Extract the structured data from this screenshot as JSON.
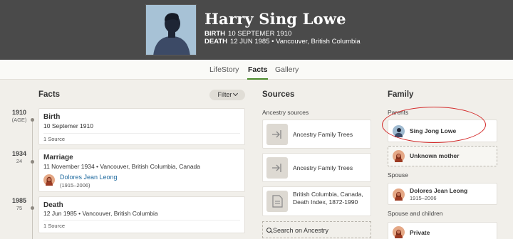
{
  "header": {
    "name": "Harry Sing Lowe",
    "birth": {
      "label": "BIRTH",
      "value": "10 SEPTEMER 1910"
    },
    "death": {
      "label": "DEATH",
      "value": "12 JUN 1985 • Vancouver, British Columbia"
    }
  },
  "tabs": [
    {
      "label": "LifeStory",
      "active": false
    },
    {
      "label": "Facts",
      "active": true
    },
    {
      "label": "Gallery",
      "active": false
    }
  ],
  "facts": {
    "heading": "Facts",
    "filter_label": "Filter",
    "items": [
      {
        "year": "1910",
        "age": "(AGE)",
        "title": "Birth",
        "date": "10 Septemer 1910",
        "sources": "1 Source"
      },
      {
        "year": "1934",
        "age": "24",
        "title": "Marriage",
        "date": "11 November 1934 • Vancouver, British Columbia, Canada",
        "person_name": "Dolores Jean Leong",
        "person_years": "(1915–2006)"
      },
      {
        "year": "1985",
        "age": "75",
        "title": "Death",
        "date": "12 Jun 1985 • Vancouver, British Columbia",
        "sources": "1 Source"
      }
    ]
  },
  "sources": {
    "heading": "Sources",
    "subheading": "Ancestry sources",
    "items": [
      {
        "label": "Ancestry Family Trees",
        "icon": "tree-icon"
      },
      {
        "label": "Ancestry Family Trees",
        "icon": "tree-icon"
      },
      {
        "label": "British Columbia, Canada, Death Index, 1872-1990",
        "icon": "document-icon"
      }
    ],
    "search_label": "Search on Ancestry"
  },
  "family": {
    "heading": "Family",
    "parents_label": "Parents",
    "parents": [
      {
        "name": "Sing Jong Lowe",
        "gender": "male"
      },
      {
        "name": "Unknown mother",
        "gender": "female"
      }
    ],
    "spouse_label": "Spouse",
    "spouse": {
      "name": "Dolores Jean Leong",
      "years": "1915–2006"
    },
    "spouse_children_label": "Spouse and children",
    "children": [
      {
        "name": "Private"
      }
    ]
  },
  "colors": {
    "header_bg": "#4a4a4a",
    "accent": "#4a8a2a",
    "link": "#1f6a9f",
    "highlight": "#d32525"
  }
}
